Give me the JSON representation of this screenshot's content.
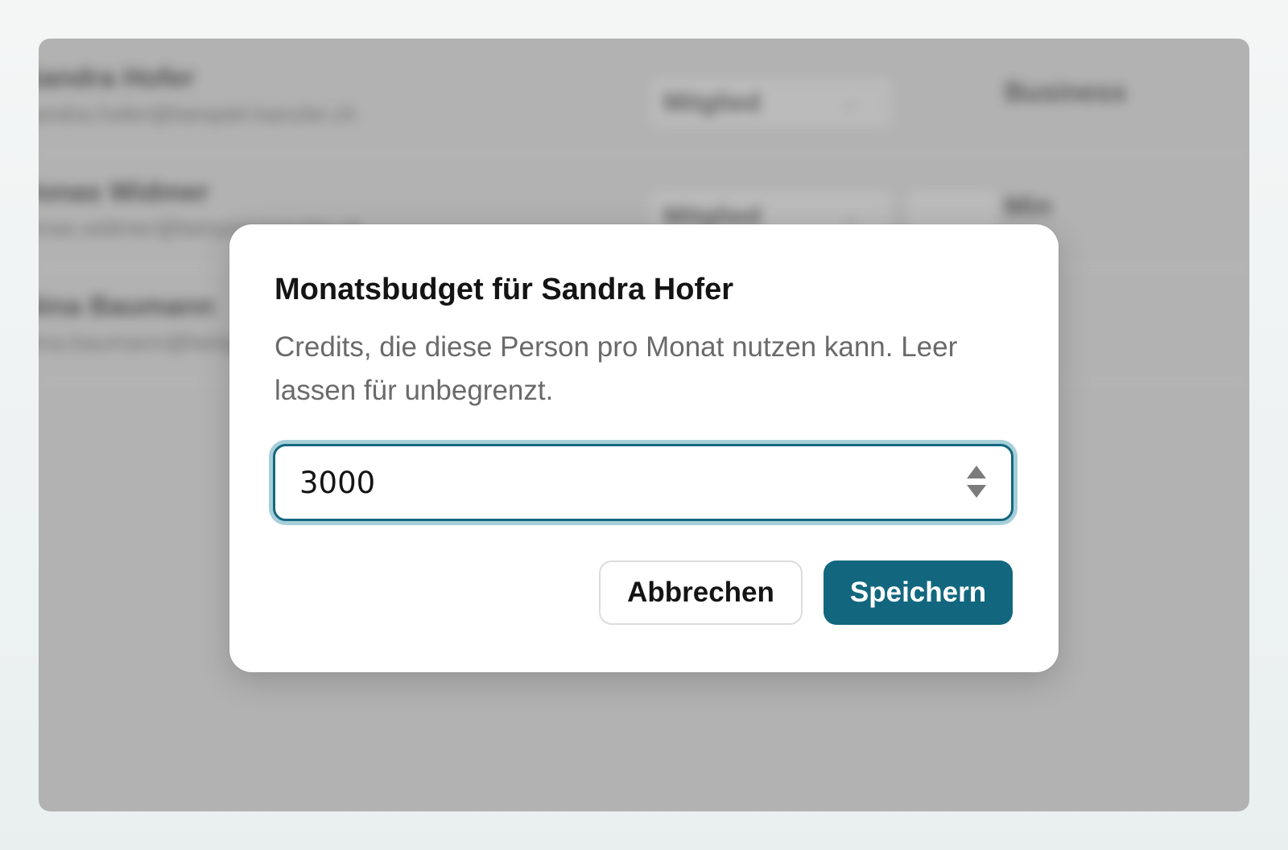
{
  "background": {
    "rows": [
      {
        "name": "Sandra Hofer",
        "email": "sandra.hofer@beispiel-kanzlei.ch",
        "role": "Mitglied",
        "plan": "Business"
      },
      {
        "name": "Jonas Widmer",
        "email": "jonas.widmer@beispiel-kanzlei.ch",
        "role": "Mitglied",
        "plan": "Min"
      },
      {
        "name": "Nina Baumann",
        "email": "nina.baumann@beispiel-kanzlei.ch",
        "role": "",
        "plan": ""
      }
    ]
  },
  "dialog": {
    "title": "Monatsbudget für Sandra Hofer",
    "description": "Credits, die diese Person pro Monat nutzen kann. Leer lassen für unbegrenzt.",
    "input_value": "3000",
    "cancel_label": "Abbrechen",
    "save_label": "Speichern"
  },
  "colors": {
    "accent": "#12677f",
    "focus_ring": "#a6cfd9",
    "overlay": "#b2b2b2"
  },
  "icons": {
    "stepper": "number-stepper-icon"
  }
}
